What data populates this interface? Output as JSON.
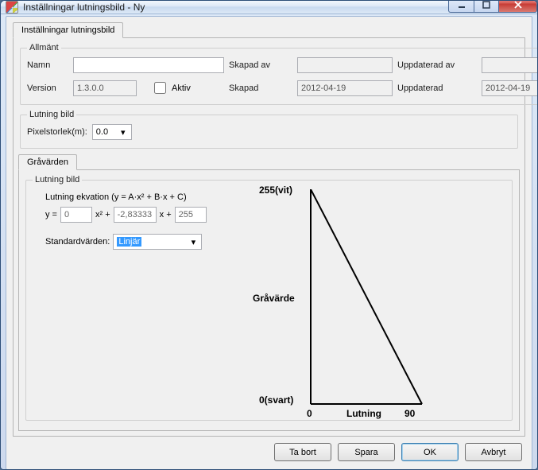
{
  "window": {
    "title": "Inställningar lutningsbild - Ny"
  },
  "tabs": {
    "main": "Inställningar lutningsbild",
    "grayvalues": "Gråvärden"
  },
  "general": {
    "legend": "Allmänt",
    "name_label": "Namn",
    "name_value": "",
    "createdby_label": "Skapad av",
    "createdby_value": "",
    "updatedby_label": "Uppdaterad av",
    "updatedby_value": "",
    "version_label": "Version",
    "version_value": "1.3.0.0",
    "active_label": "Aktiv",
    "created_label": "Skapad",
    "created_value": "2012-04-19",
    "updated_label": "Uppdaterad",
    "updated_value": "2012-04-19"
  },
  "slope_image": {
    "legend": "Lutning bild",
    "pixelsize_label": "Pixelstorlek(m):",
    "pixelsize_value": "0.0"
  },
  "equation": {
    "legend": "Lutning bild",
    "text": "Lutning ekvation (y = A·x² + B·x + C)",
    "y_eq": "y =",
    "A": "0",
    "x2_plus": "x² +",
    "B": "-2,83333",
    "x_plus": "x +",
    "C": "255",
    "std_label": "Standardvärden:",
    "std_value": "Linjär"
  },
  "chart_labels": {
    "y_top": "255(vit)",
    "y_mid": "Gråvärde",
    "y_bot": "0(svart)",
    "x_0": "0",
    "x_mid": "Lutning",
    "x_90": "90"
  },
  "chart_data": {
    "type": "line",
    "x": [
      0,
      90
    ],
    "values": [
      255,
      0
    ],
    "xlabel": "Lutning",
    "ylabel": "Gråvärde",
    "xlim": [
      0,
      90
    ],
    "ylim": [
      0,
      255
    ],
    "equation": {
      "A": 0,
      "B": -2.83333,
      "C": 255
    }
  },
  "buttons": {
    "delete": "Ta bort",
    "save": "Spara",
    "ok": "OK",
    "cancel": "Avbryt"
  }
}
